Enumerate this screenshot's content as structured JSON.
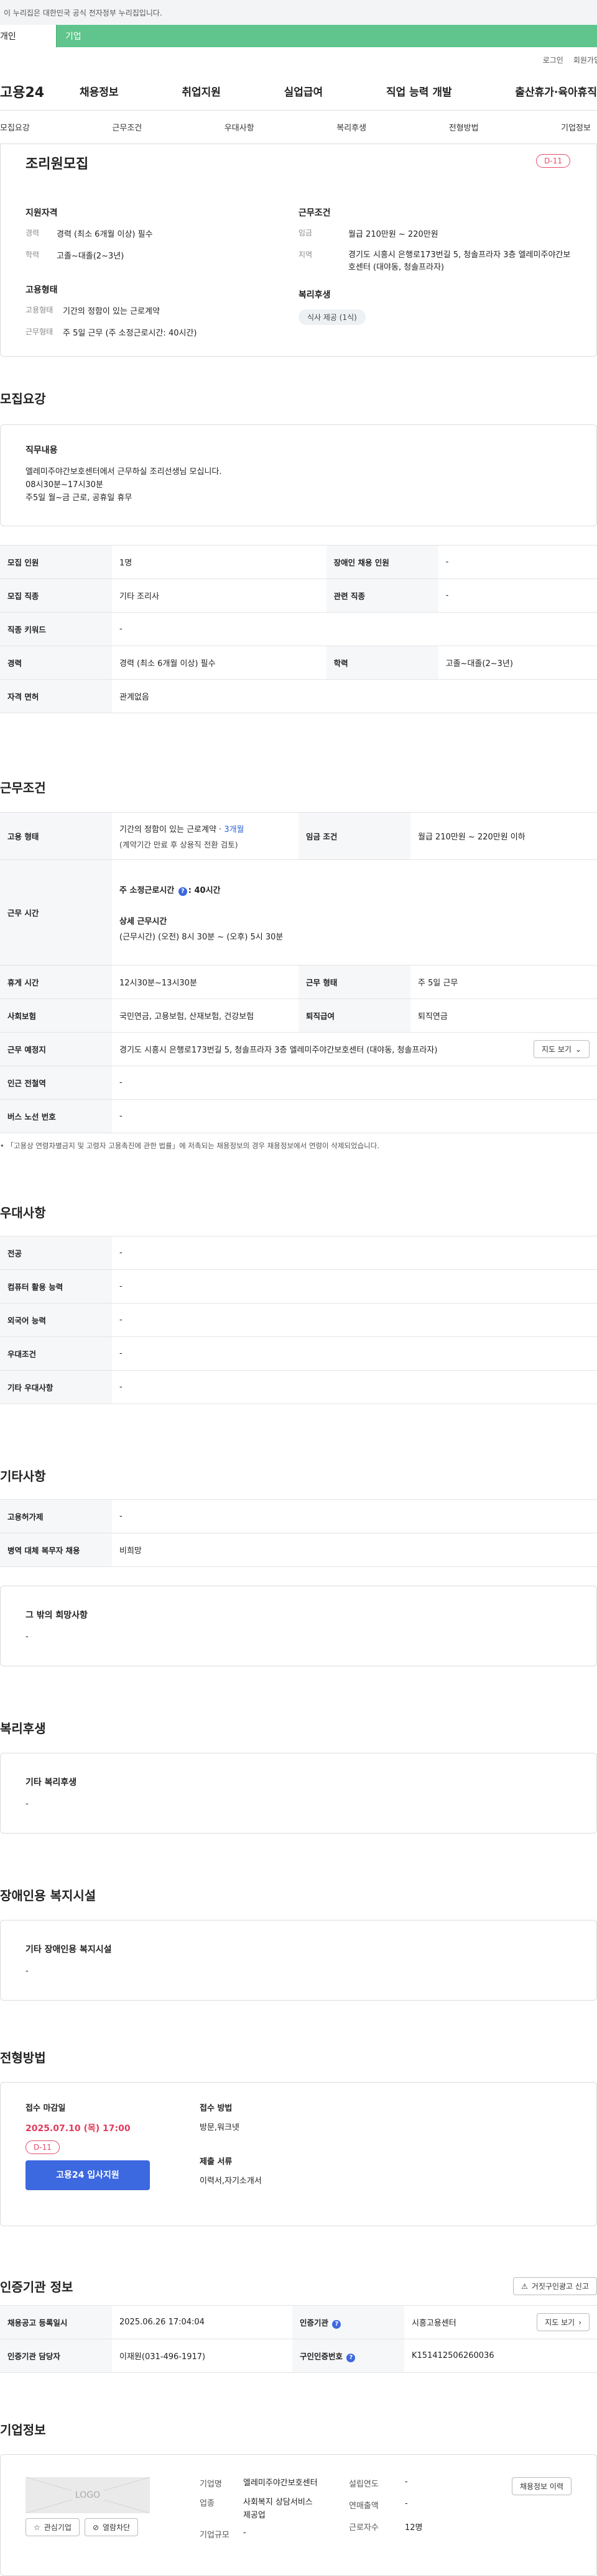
{
  "gov_banner": "이 누리집은 대한민국 공식 전자정부 누리집입니다.",
  "tabs": [
    "개인",
    "기업"
  ],
  "util": [
    "로그인",
    "회원가입"
  ],
  "logo": "고용24",
  "gnb": [
    "채용정보",
    "취업지원",
    "실업급여",
    "직업 능력 개발",
    "출산휴가·육아휴직"
  ],
  "anchors": [
    "모집요강",
    "근무조건",
    "우대사항",
    "복리후생",
    "전형방법",
    "기업정보"
  ],
  "summary": {
    "title": "조리원모집",
    "dday": "D-11",
    "qual_h": "지원자격",
    "qual": [
      {
        "k": "경력",
        "v": "경력 (최소 6개월 이상) 필수"
      },
      {
        "k": "학력",
        "v": "고졸~대졸(2~3년)"
      }
    ],
    "emp_h": "고용형태",
    "emp": [
      {
        "k": "고용형태",
        "v": "기간의 정함이 있는 근로계약"
      },
      {
        "k": "근무형태",
        "v": "주 5일 근무 (주 소정근로시간: 40시간)"
      }
    ],
    "cond_h": "근무조건",
    "cond": [
      {
        "k": "임금",
        "v": "월급 210만원 ~ 220만원"
      },
      {
        "k": "지역",
        "v": "경기도 시흥시 은행로173번길 5, 청솔프라자 3층 엘레미주야간보호센터 (대야동, 청솔프라자)"
      }
    ],
    "welf_h": "복리후생",
    "welf_chip": "식사 제공 (1식)"
  },
  "recruit": {
    "title": "모집요강",
    "job_h": "직무내용",
    "job_lines": [
      "엘레미주야간보호센터에서 근무하실 조리선생님 모십니다.",
      "08시30분~17시30분",
      "주5일 월~금 근로, 공휴일 휴무"
    ],
    "rows": [
      {
        "k1": "모집 인원",
        "v1": "1명",
        "k2": "장애인 채용 인원",
        "v2": "-"
      },
      {
        "k1": "모집 직종",
        "v1": "기타 조리사",
        "k2": "관련 직종",
        "v2": "-"
      },
      {
        "k1": "직종 키워드",
        "v1": "-"
      },
      {
        "k1": "경력",
        "v1": "경력 (최소 6개월 이상) 필수",
        "k2": "학력",
        "v2": "고졸~대졸(2~3년)"
      },
      {
        "k1": "자격 면허",
        "v1": "관계없음"
      }
    ]
  },
  "work": {
    "title": "근무조건",
    "emp_k": "고용 형태",
    "emp_v1": "기간의 정함이 있는 근로계약 · ",
    "emp_v1b": "3개월",
    "emp_v2": "(계약기간 만료 후 상용직 전환 검토)",
    "pay_k": "임금 조건",
    "pay_v": "월급 210만원 ~ 220만원 이하",
    "time_k": "근무 시간",
    "time_v1": "주 소정근로시간",
    "time_v1b": ": 40시간",
    "time_v2": "상세 근무시간",
    "time_v3": "(근무시간) (오전) 8시 30분 ~ (오후) 5시 30분",
    "rest_k": "휴게 시간",
    "rest_v": "12시30분~13시30분",
    "form_k": "근무 형태",
    "form_v": "주 5일 근무",
    "ins_k": "사회보험",
    "ins_v": "국민연금, 고용보험, 산재보험, 건강보험",
    "sev_k": "퇴직급여",
    "sev_v": "퇴직연금",
    "place_k": "근무 예정지",
    "place_v": "경기도 시흥시 은행로173번길 5, 청솔프라자 3층 엘레미주야간보호센터 (대야동, 청솔프라자)",
    "map_btn": "지도 보기",
    "subway_k": "인근 전철역",
    "subway_v": "-",
    "bus_k": "버스 노선 번호",
    "bus_v": "-",
    "note": "「고용상 연령차별금지 및 고령자 고용촉진에 관한 법률」에 저촉되는 채용정보의 경우 채용정보에서 연령이 삭제되었습니다."
  },
  "pref": {
    "title": "우대사항",
    "rows": [
      {
        "k": "전공",
        "v": "-"
      },
      {
        "k": "컴퓨터 활용 능력",
        "v": "-"
      },
      {
        "k": "외국어 능력",
        "v": "-"
      },
      {
        "k": "우대조건",
        "v": "-"
      },
      {
        "k": "기타 우대사항",
        "v": "-"
      }
    ]
  },
  "etc": {
    "title": "기타사항",
    "rows": [
      {
        "k": "고용허가제",
        "v": "-"
      },
      {
        "k": "병역 대체 복무자 채용",
        "v": "비희망"
      }
    ],
    "box_h": "그 밖의 희망사항",
    "box_v": "-"
  },
  "welfare": {
    "title": "복리후생",
    "box_h": "기타 복리후생",
    "box_v": "-"
  },
  "disability": {
    "title": "장애인용 복지시설",
    "box_h": "기타 장애인용 복지시설",
    "box_v": "-"
  },
  "process": {
    "title": "전형방법",
    "deadline_h": "접수 마감일",
    "deadline": "2025.07.10 (목) 17:00",
    "dday": "D-11",
    "apply_btn": "고용24 입사지원",
    "method_h": "접수 방법",
    "method_v": "방문,워크넷",
    "docs_h": "제출 서류",
    "docs_v": "이력서,자기소개서"
  },
  "cert": {
    "title": "인증기관 정보",
    "report_btn": "거짓구인광고 신고",
    "rows": [
      {
        "k1": "채용공고 등록일시",
        "v1": "2025.06.26 17:04:04",
        "k2": "인증기관",
        "v2": "시흥고용센터",
        "btn": "지도 보기"
      },
      {
        "k1": "인증기관 담당자",
        "v1": "이재원(031-496-1917)",
        "k2": "구인인증번호",
        "v2": "K151412506260036"
      }
    ]
  },
  "company": {
    "title": "기업정보",
    "logo_ph": "LOGO",
    "fav_btn": "관심기업",
    "block_btn": "열람차단",
    "name_k": "기업명",
    "name_v": "엘레미주야간보호센터",
    "ind_k": "업종",
    "ind_v": "사회복지 상담서비스 제공업",
    "size_k": "기업규모",
    "size_v": "-",
    "est_k": "설립연도",
    "est_v": "-",
    "rev_k": "연매출액",
    "rev_v": "-",
    "emp_k": "근로자수",
    "emp_v": "12명",
    "history_btn": "채용정보 이력"
  }
}
